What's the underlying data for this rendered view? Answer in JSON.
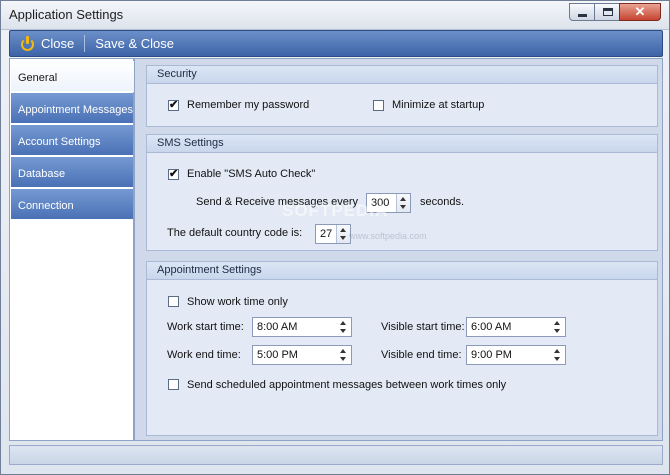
{
  "window": {
    "title": "Application Settings"
  },
  "toolbar": {
    "close_label": "Close",
    "save_close_label": "Save & Close"
  },
  "nav": {
    "items": [
      {
        "label": "General",
        "active": true
      },
      {
        "label": "Appointment Messages"
      },
      {
        "label": "Account Settings"
      },
      {
        "label": "Database"
      },
      {
        "label": "Connection"
      }
    ]
  },
  "security": {
    "title": "Security",
    "remember_password": {
      "label": "Remember my password",
      "checked": true
    },
    "minimize_startup": {
      "label": "Minimize at startup",
      "checked": false
    }
  },
  "sms": {
    "title": "SMS Settings",
    "auto_check": {
      "label": "Enable \"SMS Auto Check\"",
      "checked": true
    },
    "interval_prefix": "Send & Receive messages every",
    "interval_value": "300",
    "interval_suffix": "seconds.",
    "country_label": "The default country code is:",
    "country_value": "27"
  },
  "appointment": {
    "title": "Appointment Settings",
    "show_work_time": {
      "label": "Show work time only",
      "checked": false
    },
    "work_start_label": "Work start time:",
    "work_start_value": "8:00 AM",
    "visible_start_label": "Visible start time:",
    "visible_start_value": "6:00 AM",
    "work_end_label": "Work end time:",
    "work_end_value": "5:00 PM",
    "visible_end_label": "Visible end time:",
    "visible_end_value": "9:00 PM",
    "send_scheduled": {
      "label": "Send scheduled appointment messages between work times only",
      "checked": false
    }
  },
  "watermark": {
    "text": "SOFTPEDIA",
    "sub": "www.softpedia.com"
  }
}
